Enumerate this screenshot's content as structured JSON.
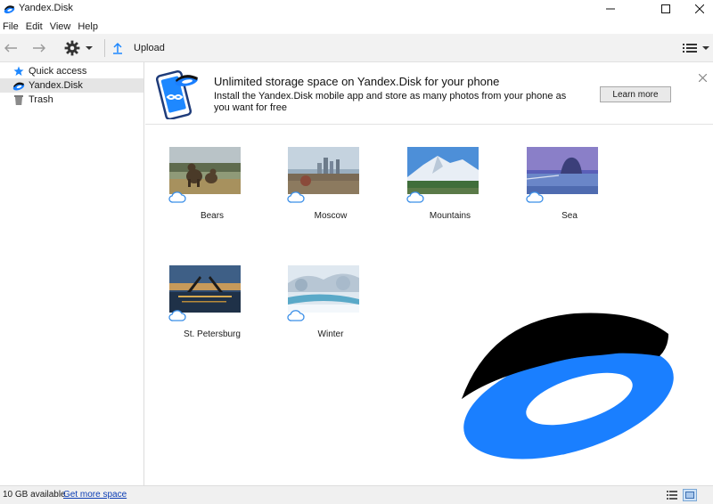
{
  "window": {
    "title": "Yandex.Disk"
  },
  "menu": [
    "File",
    "Edit",
    "View",
    "Help"
  ],
  "toolbar": {
    "upload_label": "Upload"
  },
  "sidebar": {
    "items": [
      {
        "label": "Quick access",
        "icon": "star-icon"
      },
      {
        "label": "Yandex.Disk",
        "icon": "yandex-disk-icon",
        "selected": true
      },
      {
        "label": "Trash",
        "icon": "trash-icon"
      }
    ]
  },
  "promo": {
    "title": "Unlimited storage space on Yandex.Disk for your phone",
    "text": "Install the Yandex.Disk mobile app and store as many photos from your phone as you want for free",
    "button_label": "Learn more"
  },
  "folders": [
    {
      "name": "Bears"
    },
    {
      "name": "Moscow"
    },
    {
      "name": "Mountains"
    },
    {
      "name": "Sea"
    },
    {
      "name": "St. Petersburg"
    },
    {
      "name": "Winter"
    }
  ],
  "status": {
    "available": "10 GB available",
    "more_space_link": "Get more space"
  },
  "colors": {
    "accent": "#1e88ff",
    "link": "#0a3cb4",
    "logo_blue": "#1a7fff"
  }
}
